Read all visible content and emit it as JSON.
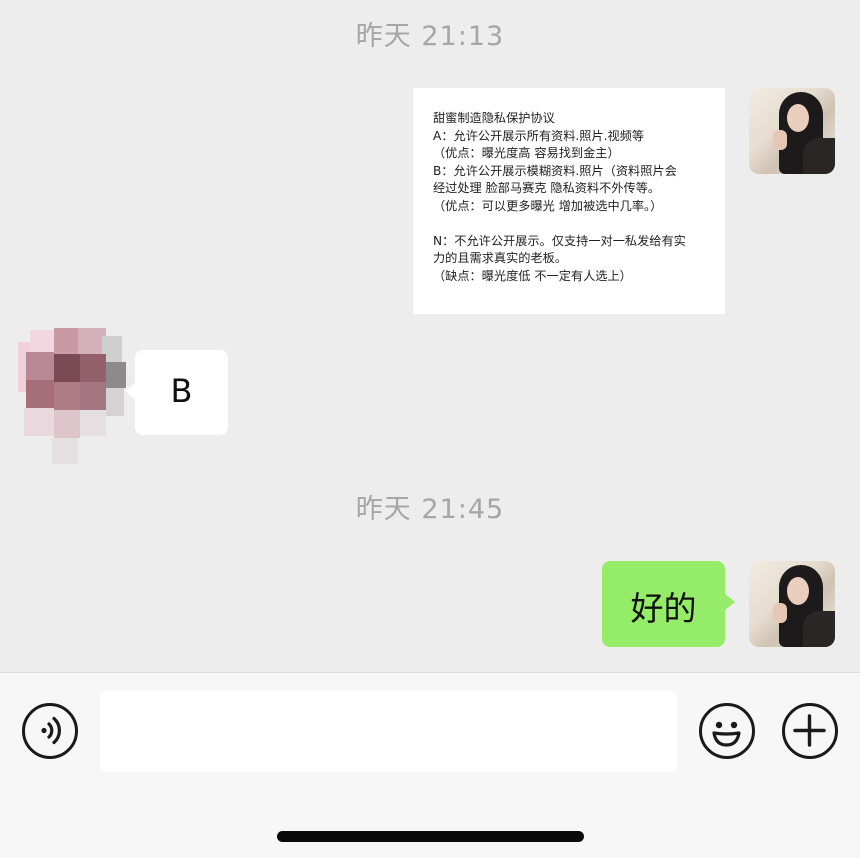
{
  "chat": {
    "timestamps": [
      "昨天 21:13",
      "昨天 21:45"
    ],
    "messages": [
      {
        "sender": "self",
        "type": "image",
        "text_lines": [
          "甜蜜制造隐私保护协议",
          "A：允许公开展示所有资料.照片.视频等",
          "（优点：曝光度高 容易找到金主）",
          "B：允许公开展示模糊资料.照片（资料照片会",
          "经过处理 脸部马赛克 隐私资料不外传等。",
          "（优点：可以更多曝光 增加被选中几率。）",
          "",
          "N：不允许公开展示。仅支持一对一私发给有实",
          "力的且需求真实的老板。",
          "（缺点：曝光度低 不一定有人选上）"
        ]
      },
      {
        "sender": "other",
        "type": "text",
        "text": "B"
      },
      {
        "sender": "self",
        "type": "text",
        "text": "好的"
      }
    ]
  },
  "input_bar": {
    "message_input_value": "",
    "icons": [
      "voice-icon",
      "emoji-icon",
      "plus-icon"
    ]
  },
  "colors": {
    "background": "#ededed",
    "self_bubble": "#95ec69",
    "other_bubble": "#ffffff",
    "timestamp": "#a6a6a6"
  }
}
